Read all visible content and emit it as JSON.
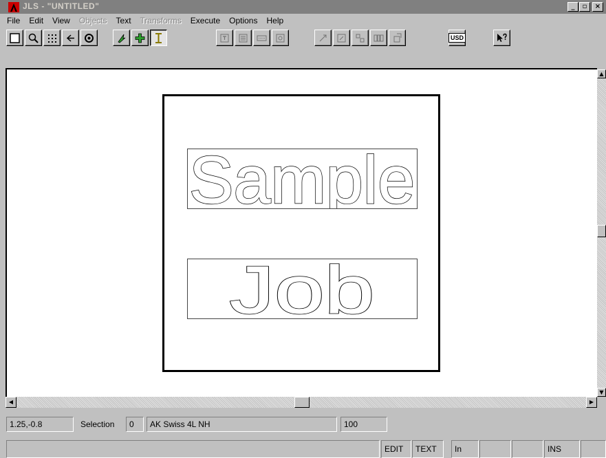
{
  "window": {
    "title": "JLS - \"UNTITLED\"",
    "buttons": {
      "minimize": "_",
      "restore": "▫",
      "close": "×"
    }
  },
  "menu": [
    {
      "label": "File",
      "enabled": true
    },
    {
      "label": "Edit",
      "enabled": true
    },
    {
      "label": "View",
      "enabled": true
    },
    {
      "label": "Objects",
      "enabled": false
    },
    {
      "label": "Text",
      "enabled": true
    },
    {
      "label": "Transforms",
      "enabled": false
    },
    {
      "label": "Execute",
      "enabled": true
    },
    {
      "label": "Options",
      "enabled": true
    },
    {
      "label": "Help",
      "enabled": true
    }
  ],
  "toolbar": {
    "usd_label": "USD",
    "icons": [
      "new-page-icon",
      "zoom-icon",
      "grid-icon",
      "back-icon",
      "view-icon",
      "pointer-icon",
      "add-object-icon",
      "text-cursor-icon",
      "align-icon",
      "list-icon",
      "field-icon",
      "image-icon",
      "resize-icon",
      "frame-icon",
      "distribute-icon",
      "columns-icon",
      "rotate-icon",
      "usd-icon",
      "context-help-icon"
    ]
  },
  "document": {
    "lines": [
      "Sample",
      "Job"
    ]
  },
  "status": {
    "coordinates": "1.25,-0.8",
    "selection_label": "Selection",
    "selection_count": "0",
    "font_name": "AK Swiss 4L NH",
    "size": "100",
    "modes": [
      "EDIT",
      "TEXT",
      "In",
      "",
      "",
      "INS",
      ""
    ]
  },
  "colors": {
    "titlebar": "#808080",
    "face": "#c0c0c0",
    "accent_green": "#2d9e2d"
  }
}
